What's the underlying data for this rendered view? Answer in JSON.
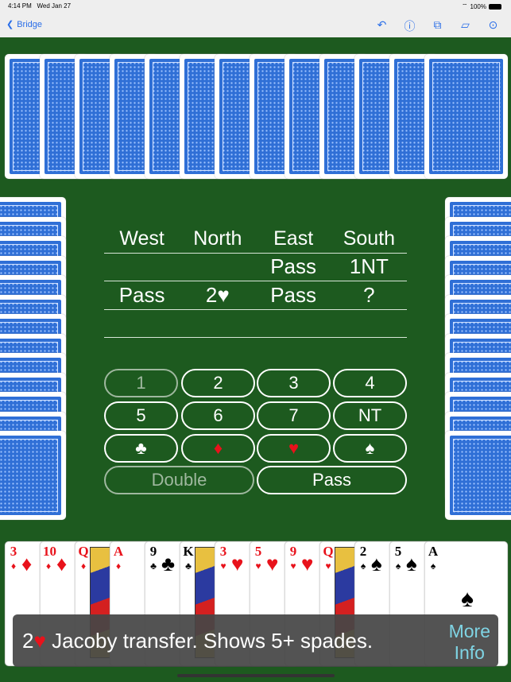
{
  "status": {
    "time": "4:14 PM",
    "date": "Wed Jan 27",
    "battery": "100%"
  },
  "nav": {
    "back_label": "Bridge",
    "tools": [
      "undo-icon",
      "help-icon",
      "hint-icon",
      "cards-icon",
      "more-icon"
    ]
  },
  "bidding": {
    "headers": [
      "West",
      "North",
      "East",
      "South"
    ],
    "rows": [
      [
        "",
        "",
        "Pass",
        "1NT"
      ],
      [
        "Pass",
        "2♥",
        "Pass",
        "?"
      ],
      [
        "",
        "",
        "",
        ""
      ]
    ]
  },
  "bid_buttons": {
    "levels": [
      "1",
      "2",
      "3",
      "4",
      "5",
      "6",
      "7",
      "NT"
    ],
    "suits": [
      "♣",
      "♦",
      "♥",
      "♠"
    ],
    "double": "Double",
    "pass": "Pass",
    "disabled": [
      "1",
      "Double"
    ]
  },
  "hand": [
    {
      "rank": "3",
      "suit": "♦"
    },
    {
      "rank": "10",
      "suit": "♦"
    },
    {
      "rank": "Q",
      "suit": "♦"
    },
    {
      "rank": "A",
      "suit": "♦"
    },
    {
      "rank": "9",
      "suit": "♣"
    },
    {
      "rank": "K",
      "suit": "♣"
    },
    {
      "rank": "3",
      "suit": "♥"
    },
    {
      "rank": "5",
      "suit": "♥"
    },
    {
      "rank": "9",
      "suit": "♥"
    },
    {
      "rank": "Q",
      "suit": "♥"
    },
    {
      "rank": "2",
      "suit": "♠"
    },
    {
      "rank": "5",
      "suit": "♠"
    },
    {
      "rank": "A",
      "suit": "♠"
    }
  ],
  "info": {
    "bid": "2",
    "bid_suit": "♥",
    "text": "Jacoby transfer. Shows 5+ spades.",
    "more_1": "More",
    "more_2": "Info"
  },
  "colors": {
    "table": "#1d5a1f",
    "accent": "#2a6ee8",
    "red_suit": "#e8121b",
    "link": "#7fd4e4"
  }
}
